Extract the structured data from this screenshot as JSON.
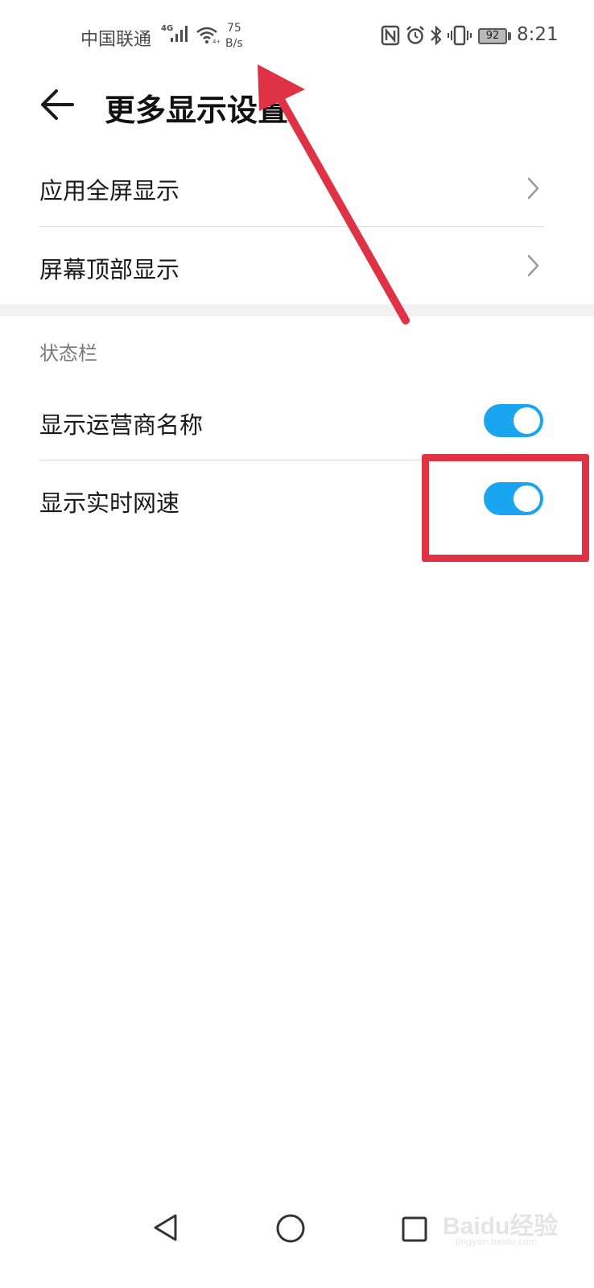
{
  "status_bar": {
    "carrier": "中国联通",
    "network_type": "4G",
    "speed_value": "75",
    "speed_unit": "B/s",
    "battery": "92",
    "time": "8:21"
  },
  "header": {
    "title": "更多显示设置"
  },
  "nav_rows": [
    {
      "label": "应用全屏显示"
    },
    {
      "label": "屏幕顶部显示"
    }
  ],
  "status_section": {
    "header": "状态栏",
    "toggles": [
      {
        "label": "显示运营商名称",
        "on": true
      },
      {
        "label": "显示实时网速",
        "on": true
      }
    ]
  },
  "colors": {
    "accent": "#1aa5f1",
    "annotation": "#e03245"
  },
  "watermark": {
    "brand": "Baidu经验",
    "url": "jingyan.baidu.com"
  }
}
